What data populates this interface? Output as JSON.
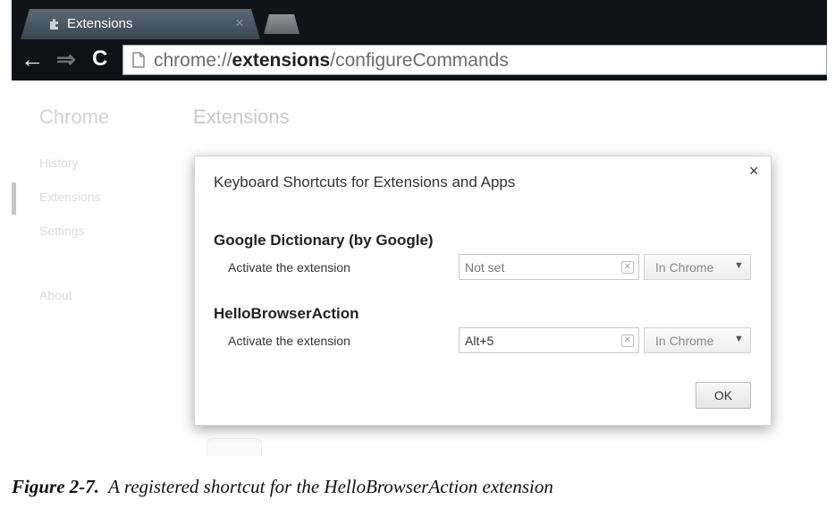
{
  "browser": {
    "tab": {
      "title": "Extensions",
      "close": "×",
      "icon": "puzzle-icon"
    },
    "nav": {
      "back": "🡐",
      "forward": "⇒",
      "reload": "C"
    },
    "omnibox": {
      "prefix": "chrome://",
      "host": "extensions",
      "path": "/configureCommands"
    }
  },
  "page": {
    "sidebar_title": "Chrome",
    "main_title": "Extensions",
    "sidebar": {
      "history": "History",
      "extensions": "Extensions",
      "settings": "Settings",
      "about": "About"
    }
  },
  "dialog": {
    "title": "Keyboard Shortcuts for Extensions and Apps",
    "close": "×",
    "extensions": [
      {
        "name": "Google Dictionary (by Google)",
        "command": "Activate the extension",
        "shortcut": "Not set",
        "scope": "In Chrome"
      },
      {
        "name": "HelloBrowserAction",
        "command": "Activate the extension",
        "shortcut": "Alt+5",
        "scope": "In Chrome"
      }
    ],
    "ok_label": "OK"
  },
  "caption": {
    "label": "Figure 2-7.",
    "text": "A registered shortcut for the HelloBrowserAction extension"
  },
  "colors": {
    "frame": "#101418",
    "tab": "#4a5862",
    "dialog_border": "#d6d6d6"
  }
}
